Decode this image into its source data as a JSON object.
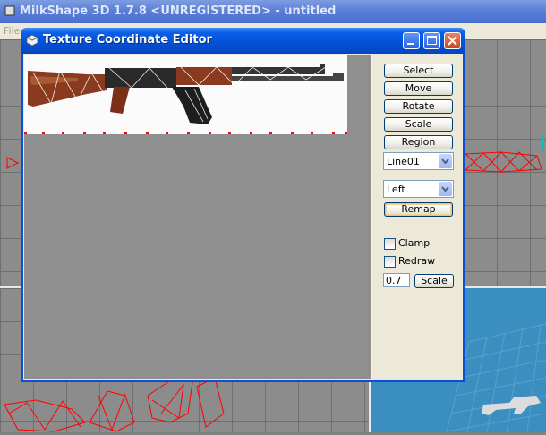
{
  "app": {
    "title": "MilkShape 3D 1.7.8 <UNREGISTERED> - untitled",
    "menu_first": "File"
  },
  "dialog": {
    "title": "Texture Coordinate Editor",
    "buttons": {
      "select": "Select",
      "move": "Move",
      "rotate": "Rotate",
      "scale": "Scale",
      "region": "Region",
      "remap": "Remap",
      "scale_apply": "Scale"
    },
    "group_combo": {
      "value": "Line01"
    },
    "direction_combo": {
      "value": "Left"
    },
    "clamp": {
      "label": "Clamp",
      "checked": false
    },
    "redraw": {
      "label": "Redraw",
      "checked": false
    },
    "scale_value": "0.7"
  },
  "colors": {
    "title_blue": "#0a5ee6",
    "dialog_face": "#ece9d8",
    "uv_canvas": "#8f8f8f",
    "mesh_red": "#ff0000",
    "viewport_grid": "#8c8c8c",
    "viewport_3d": "#3b8fc0"
  }
}
